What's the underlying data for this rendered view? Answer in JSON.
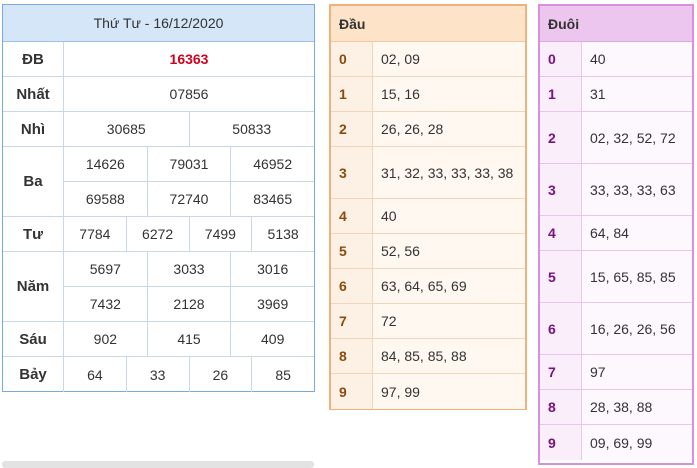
{
  "results": {
    "title": "Thứ Tư - 16/12/2020",
    "rows": [
      {
        "label": "ĐB",
        "lines": [
          [
            "16363"
          ]
        ]
      },
      {
        "label": "Nhất",
        "lines": [
          [
            "07856"
          ]
        ]
      },
      {
        "label": "Nhì",
        "lines": [
          [
            "30685",
            "50833"
          ]
        ]
      },
      {
        "label": "Ba",
        "lines": [
          [
            "14626",
            "79031",
            "46952"
          ],
          [
            "69588",
            "72740",
            "83465"
          ]
        ]
      },
      {
        "label": "Tư",
        "lines": [
          [
            "7784",
            "6272",
            "7499",
            "5138"
          ]
        ]
      },
      {
        "label": "Năm",
        "lines": [
          [
            "5697",
            "3033",
            "3016"
          ],
          [
            "7432",
            "2128",
            "3969"
          ]
        ]
      },
      {
        "label": "Sáu",
        "lines": [
          [
            "902",
            "415",
            "409"
          ]
        ]
      },
      {
        "label": "Bảy",
        "lines": [
          [
            "64",
            "33",
            "26",
            "85"
          ]
        ]
      }
    ]
  },
  "dau": {
    "header": "Đầu",
    "rows": [
      {
        "k": "0",
        "v": "02, 09"
      },
      {
        "k": "1",
        "v": "15, 16"
      },
      {
        "k": "2",
        "v": "26, 26, 28"
      },
      {
        "k": "3",
        "v": "31, 32, 33, 33, 33, 38"
      },
      {
        "k": "4",
        "v": "40"
      },
      {
        "k": "5",
        "v": "52, 56"
      },
      {
        "k": "6",
        "v": "63, 64, 65, 69"
      },
      {
        "k": "7",
        "v": "72"
      },
      {
        "k": "8",
        "v": "84, 85, 85, 88"
      },
      {
        "k": "9",
        "v": "97, 99"
      }
    ]
  },
  "duoi": {
    "header": "Đuôi",
    "rows": [
      {
        "k": "0",
        "v": "40"
      },
      {
        "k": "1",
        "v": "31"
      },
      {
        "k": "2",
        "v": "02, 32, 52, 72"
      },
      {
        "k": "3",
        "v": "33, 33, 33, 63"
      },
      {
        "k": "4",
        "v": "64, 84"
      },
      {
        "k": "5",
        "v": "15, 65, 85, 85"
      },
      {
        "k": "6",
        "v": "16, 26, 26, 56"
      },
      {
        "k": "7",
        "v": "97"
      },
      {
        "k": "8",
        "v": "28, 38, 88"
      },
      {
        "k": "9",
        "v": "09, 69, 99"
      }
    ]
  },
  "colors": {
    "special_prize": "#d0021b",
    "results_header_bg": "#d4e6f8",
    "dau_border": "#f0b27a",
    "duoi_border": "#d98fdc"
  }
}
